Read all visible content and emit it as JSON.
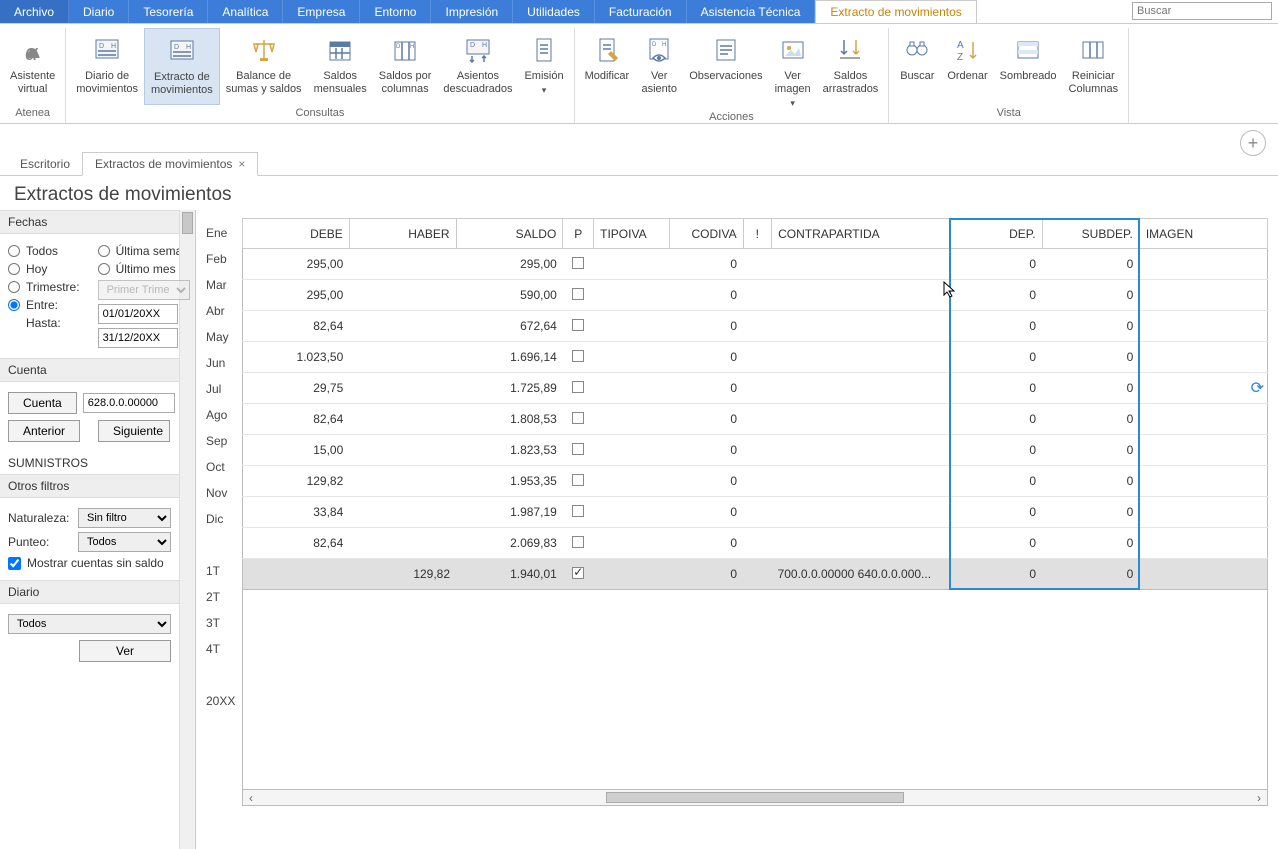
{
  "menu": {
    "items": [
      "Archivo",
      "Diario",
      "Tesorería",
      "Analítica",
      "Empresa",
      "Entorno",
      "Impresión",
      "Utilidades",
      "Facturación",
      "Asistencia Técnica",
      "Extracto de movimientos"
    ],
    "active_index": 10,
    "search_placeholder": "Buscar"
  },
  "ribbon": {
    "groups": [
      {
        "label": "Atenea",
        "buttons": [
          {
            "name": "asistente-virtual",
            "label": "Asistente\nvirtual",
            "icon": "alpha"
          }
        ]
      },
      {
        "label": "Consultas",
        "buttons": [
          {
            "name": "diario-movimientos",
            "label": "Diario de\nmovimientos",
            "icon": "dh"
          },
          {
            "name": "extracto-movimientos",
            "label": "Extracto de\nmovimientos",
            "icon": "dh",
            "active": true
          },
          {
            "name": "balance-sumas-saldos",
            "label": "Balance de\nsumas y saldos",
            "icon": "scales"
          },
          {
            "name": "saldos-mensuales",
            "label": "Saldos\nmensuales",
            "icon": "calendar"
          },
          {
            "name": "saldos-columnas",
            "label": "Saldos por\ncolumnas",
            "icon": "columns"
          },
          {
            "name": "asientos-descuadrados",
            "label": "Asientos\ndescuadrados",
            "icon": "dh-arrows"
          },
          {
            "name": "emision",
            "label": "Emisión",
            "icon": "doc",
            "dropdown": true
          }
        ]
      },
      {
        "label": "Acciones",
        "buttons": [
          {
            "name": "modificar",
            "label": "Modificar",
            "icon": "doc-pencil"
          },
          {
            "name": "ver-asiento",
            "label": "Ver\nasiento",
            "icon": "doc-eye"
          },
          {
            "name": "observaciones",
            "label": "Observaciones",
            "icon": "note"
          },
          {
            "name": "ver-imagen",
            "label": "Ver\nimagen",
            "icon": "image",
            "dropdown": true
          },
          {
            "name": "saldos-arrastrados",
            "label": "Saldos\narrastrados",
            "icon": "arrows-down"
          }
        ]
      },
      {
        "label": "Vista",
        "buttons": [
          {
            "name": "buscar",
            "label": "Buscar",
            "icon": "binoculars"
          },
          {
            "name": "ordenar",
            "label": "Ordenar",
            "icon": "sort-az"
          },
          {
            "name": "sombreado",
            "label": "Sombreado",
            "icon": "shade"
          },
          {
            "name": "reiniciar-columnas",
            "label": "Reiniciar\nColumnas",
            "icon": "reset-cols"
          }
        ]
      }
    ]
  },
  "doc_tabs": {
    "items": [
      {
        "label": "Escritorio",
        "closable": false
      },
      {
        "label": "Extractos de movimientos",
        "closable": true,
        "active": true
      }
    ]
  },
  "page": {
    "title": "Extractos de movimientos"
  },
  "sidebar": {
    "fechas_header": "Fechas",
    "radio_todos": "Todos",
    "radio_ultima_semana": "Última semana",
    "radio_hoy": "Hoy",
    "radio_ultimo_mes": "Último mes",
    "radio_trimestre": "Trimestre:",
    "trimestre_value": "Primer Trimestre",
    "radio_entre": "Entre:",
    "entre_value": "01/01/20XX",
    "hasta_label": "Hasta:",
    "hasta_value": "31/12/20XX",
    "cuenta_header": "Cuenta",
    "btn_cuenta": "Cuenta",
    "cuenta_value": "628.0.0.00000",
    "btn_anterior": "Anterior",
    "btn_siguiente": "Siguiente",
    "cuenta_nombre": "SUMNISTROS",
    "otros_header": "Otros filtros",
    "naturaleza_label": "Naturaleza:",
    "naturaleza_value": "Sin filtro",
    "punteo_label": "Punteo:",
    "punteo_value": "Todos",
    "mostrar_sin_saldo": "Mostrar cuentas sin saldo",
    "diario_header": "Diario",
    "diario_value": "Todos",
    "btn_ver": "Ver"
  },
  "months": [
    "Ene",
    "Feb",
    "Mar",
    "Abr",
    "May",
    "Jun",
    "Jul",
    "Ago",
    "Sep",
    "Oct",
    "Nov",
    "Dic",
    "",
    "1T",
    "2T",
    "3T",
    "4T",
    "",
    "20XX"
  ],
  "table": {
    "columns": [
      "DEBE",
      "HABER",
      "SALDO",
      "P",
      "TIPOIVA",
      "CODIVA",
      "!",
      "CONTRAPARTIDA",
      "DEP.",
      "SUBDEP.",
      "IMAGEN"
    ],
    "rows": [
      {
        "debe": "295,00",
        "haber": "",
        "saldo": "295,00",
        "p": false,
        "codiva": "0",
        "contra": "",
        "dep": "0",
        "subdep": "0"
      },
      {
        "debe": "295,00",
        "haber": "",
        "saldo": "590,00",
        "p": false,
        "codiva": "0",
        "contra": "",
        "dep": "0",
        "subdep": "0"
      },
      {
        "debe": "82,64",
        "haber": "",
        "saldo": "672,64",
        "p": false,
        "codiva": "0",
        "contra": "",
        "dep": "0",
        "subdep": "0"
      },
      {
        "debe": "1.023,50",
        "haber": "",
        "saldo": "1.696,14",
        "p": false,
        "codiva": "0",
        "contra": "",
        "dep": "0",
        "subdep": "0"
      },
      {
        "debe": "29,75",
        "haber": "",
        "saldo": "1.725,89",
        "p": false,
        "codiva": "0",
        "contra": "",
        "dep": "0",
        "subdep": "0"
      },
      {
        "debe": "82,64",
        "haber": "",
        "saldo": "1.808,53",
        "p": false,
        "codiva": "0",
        "contra": "",
        "dep": "0",
        "subdep": "0"
      },
      {
        "debe": "15,00",
        "haber": "",
        "saldo": "1.823,53",
        "p": false,
        "codiva": "0",
        "contra": "",
        "dep": "0",
        "subdep": "0"
      },
      {
        "debe": "129,82",
        "haber": "",
        "saldo": "1.953,35",
        "p": false,
        "codiva": "0",
        "contra": "",
        "dep": "0",
        "subdep": "0"
      },
      {
        "debe": "33,84",
        "haber": "",
        "saldo": "1.987,19",
        "p": false,
        "codiva": "0",
        "contra": "",
        "dep": "0",
        "subdep": "0"
      },
      {
        "debe": "82,64",
        "haber": "",
        "saldo": "2.069,83",
        "p": false,
        "codiva": "0",
        "contra": "",
        "dep": "0",
        "subdep": "0"
      },
      {
        "debe": "",
        "haber": "129,82",
        "saldo": "1.940,01",
        "p": true,
        "codiva": "0",
        "contra": "700.0.0.00000 640.0.0.000...",
        "dep": "0",
        "subdep": "0",
        "selected": true
      }
    ]
  }
}
